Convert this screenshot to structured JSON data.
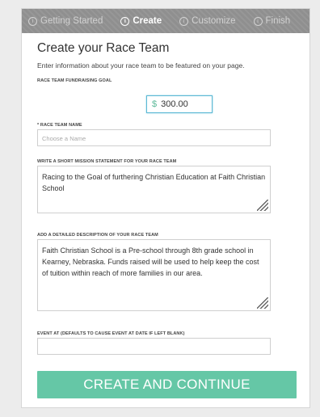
{
  "steps": [
    {
      "label": "Getting Started",
      "icon": "i"
    },
    {
      "label": "Create",
      "icon": "i"
    },
    {
      "label": "Customize",
      "icon": "i"
    },
    {
      "label": "Finish",
      "icon": "i"
    }
  ],
  "page": {
    "title": "Create your Race Team",
    "intro": "Enter information about your race team to be featured on your page."
  },
  "goal": {
    "label": "RACE TEAM FUNDRAISING GOAL",
    "currency": "$",
    "value": "300.00"
  },
  "team_name": {
    "label": "* RACE TEAM NAME",
    "placeholder": "Choose a Name"
  },
  "mission": {
    "label": "WRITE A SHORT MISSION STATEMENT FOR YOUR RACE TEAM",
    "value": "Racing to the Goal of furthering Christian Education at Faith Christian School"
  },
  "description": {
    "label": "ADD A DETAILED DESCRIPTION OF YOUR RACE TEAM",
    "value": "Faith Christian School is a Pre-school through 8th grade school in Kearney, Nebraska. Funds raised will be used to help keep the cost of tuition within reach of more families in our area."
  },
  "event": {
    "label": "EVENT AT (DEFAULTS TO CAUSE EVENT AT DATE IF LEFT BLANK)",
    "value": ""
  },
  "cta": {
    "label": "CREATE AND CONTINUE",
    "color": "#65c7a6"
  },
  "colors": {
    "header_bg": "#8f8f8f",
    "accent_currency": "#5cb999",
    "focus_border": "#5bb8d4"
  }
}
